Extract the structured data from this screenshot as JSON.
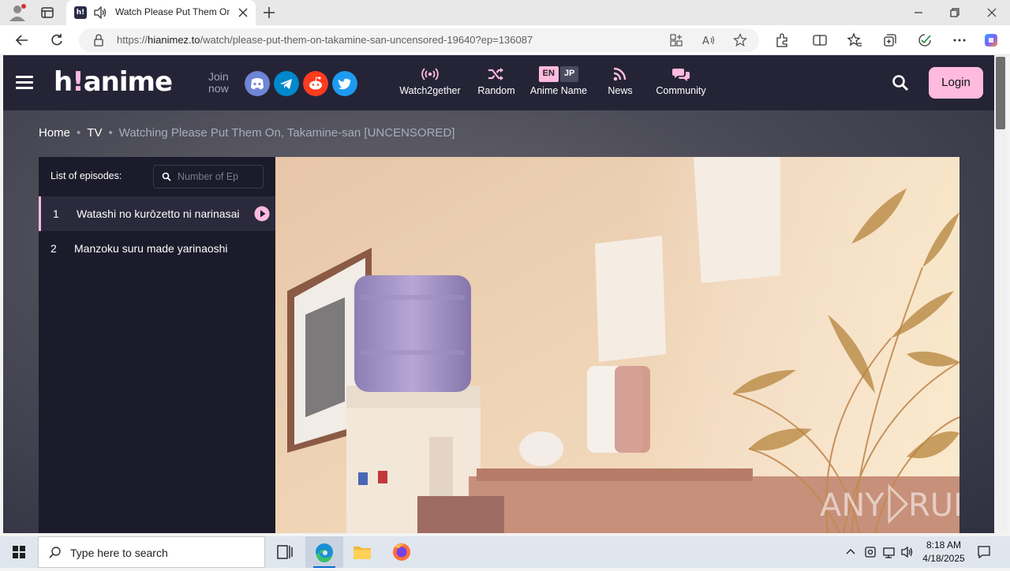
{
  "browser": {
    "tab": {
      "title": "Watch Please Put Them On, Takamine-san [UNCENSORED]",
      "favicon_text": "h!"
    },
    "address": {
      "prefix": "https://",
      "host": "hianimez.to",
      "path": "/watch/please-put-them-on-takamine-san-uncensored-19640?ep=136087"
    }
  },
  "site": {
    "logo": {
      "h": "h",
      "bang": "!",
      "rest": "anime"
    },
    "join_label": {
      "line1": "Join",
      "line2": "now"
    },
    "socials": [
      "discord-icon",
      "telegram-icon",
      "reddit-icon",
      "twitter-icon"
    ],
    "menu": [
      {
        "label": "Watch2gether",
        "icon": "broadcast-icon"
      },
      {
        "label": "Random",
        "icon": "shuffle-icon"
      },
      {
        "label": "Anime Name",
        "badge_en": "EN",
        "badge_jp": "JP"
      },
      {
        "label": "News",
        "icon": "rss-icon"
      },
      {
        "label": "Community",
        "icon": "chat-bubbles-icon"
      }
    ],
    "login_label": "Login"
  },
  "breadcrumb": {
    "home": "Home",
    "type": "TV",
    "current": "Watching Please Put Them On, Takamine-san [UNCENSORED]"
  },
  "episodes": {
    "title": "List of episodes:",
    "search_placeholder": "Number of Ep",
    "items": [
      {
        "number": "1",
        "name": "Watashi no kurōzetto ni narinasai",
        "active": true
      },
      {
        "number": "2",
        "name": "Manzoku suru made yarinaoshi",
        "active": false
      }
    ]
  },
  "player": {
    "watermark": "ANY RUN"
  },
  "taskbar": {
    "search_placeholder": "Type here to search",
    "time": "8:18 AM",
    "date": "4/18/2025"
  },
  "colors": {
    "accent": "#ffbade",
    "header_bg": "#252437",
    "panel_bg": "#1c1b2b"
  }
}
